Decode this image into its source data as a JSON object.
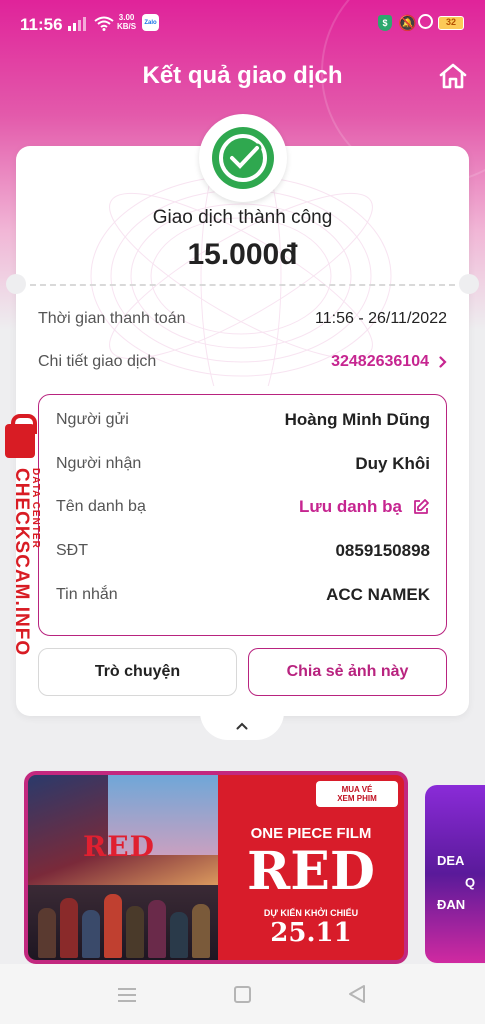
{
  "status_bar": {
    "time": "11:56",
    "net_speed_value": "3.00",
    "net_speed_unit": "KB/S",
    "zalo_label": "Zalo",
    "battery": "32"
  },
  "header": {
    "title": "Kết quả giao dịch"
  },
  "transaction": {
    "status": "Giao dịch thành công",
    "amount": "15.000đ",
    "time_label": "Thời gian thanh toán",
    "time_value": "11:56 - 26/11/2022",
    "detail_label": "Chi tiết giao dịch",
    "detail_value": "32482636104"
  },
  "details": {
    "sender_label": "Người gửi",
    "sender_value": "Hoàng Minh Dũng",
    "receiver_label": "Người nhận",
    "receiver_value": "Duy Khôi",
    "contact_label": "Tên danh bạ",
    "contact_action": "Lưu danh bạ",
    "phone_label": "SĐT",
    "phone_value": "0859150898",
    "message_label": "Tin nhắn",
    "message_value": "ACC NAMEK"
  },
  "actions": {
    "chat": "Trò chuyện",
    "share": "Chia sẻ ảnh này"
  },
  "banner": {
    "poster_title": "RED",
    "tag_line1": "MUA VÉ",
    "tag_line2": "XEM PHIM",
    "film_name": "ONE PIECE FILM",
    "film_title": "RED",
    "subtitle": "DỰ KIẾN KHỞI CHIẾU",
    "release_date": "25.11",
    "side_line1": "DEA",
    "side_line2": "Q",
    "side_line3": "ĐAN"
  },
  "watermark": {
    "main": "CHECKSCAM.INFO",
    "sub": "DATA CENTER"
  },
  "colors": {
    "brand": "#c62590",
    "success": "#2fa84f"
  }
}
